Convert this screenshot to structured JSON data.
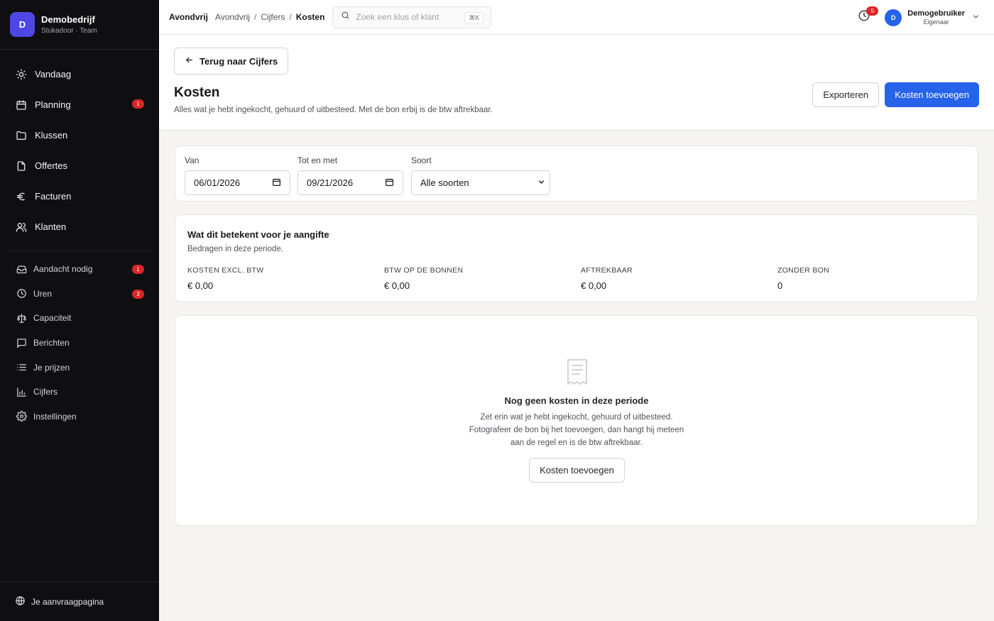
{
  "org": {
    "avatar": "D",
    "name": "Demobedrijf",
    "subtitle": "Stukadoor · Team"
  },
  "nav_main": [
    {
      "label": "Vandaag",
      "icon": "sun-icon"
    },
    {
      "label": "Planning",
      "icon": "calendar-icon",
      "badge": "1"
    },
    {
      "label": "Klussen",
      "icon": "folder-icon"
    },
    {
      "label": "Offertes",
      "icon": "document-icon"
    },
    {
      "label": "Facturen",
      "icon": "euro-icon"
    },
    {
      "label": "Klanten",
      "icon": "users-icon"
    }
  ],
  "nav_secondary": [
    {
      "label": "Aandacht nodig",
      "icon": "inbox-icon",
      "badge": "1"
    },
    {
      "label": "Uren",
      "icon": "clock-icon",
      "badge": "3"
    },
    {
      "label": "Capaciteit",
      "icon": "scale-icon"
    },
    {
      "label": "Berichten",
      "icon": "message-icon"
    },
    {
      "label": "Je prijzen",
      "icon": "list-icon"
    },
    {
      "label": "Cijfers",
      "icon": "bar-chart-icon"
    },
    {
      "label": "Instellingen",
      "icon": "gear-icon"
    }
  ],
  "sidebar_footer": {
    "label": "Je aanvraagpagina",
    "icon": "globe-icon"
  },
  "topbar": {
    "brand": "Avondvrij",
    "breadcrumb": [
      "Avondvrij",
      "Cijfers",
      "Kosten"
    ],
    "breadcrumb_sep": "/",
    "search_placeholder": "Zoek een klus of klant",
    "search_shortcut": "⌘K",
    "notification_count": "5",
    "user": {
      "avatar": "D",
      "name": "Demogebruiker",
      "role": "Eigenaar"
    }
  },
  "header": {
    "back_label": "Terug naar Cijfers",
    "title": "Kosten",
    "description": "Alles wat je hebt ingekocht, gehuurd of uitbesteed. Met de bon erbij is de btw aftrekbaar.",
    "export_label": "Exporteren",
    "add_label": "Kosten toevoegen"
  },
  "filters": {
    "from_label": "Van",
    "from_value": "06/01/2026",
    "to_label": "Tot en met",
    "to_value": "09/21/2026",
    "type_label": "Soort",
    "type_value": "Alle soorten"
  },
  "summary": {
    "title": "Wat dit betekent voor je aangifte",
    "subtitle": "Bedragen in deze periode.",
    "stats": [
      {
        "label": "KOSTEN EXCL. BTW",
        "value": "€ 0,00"
      },
      {
        "label": "BTW OP DE BONNEN",
        "value": "€ 0,00"
      },
      {
        "label": "AFTREKBAAR",
        "value": "€ 0,00"
      },
      {
        "label": "ZONDER BON",
        "value": "0"
      }
    ]
  },
  "empty": {
    "title": "Nog geen kosten in deze periode",
    "line1": "Zet erin wat je hebt ingekocht, gehuurd of uitbesteed.",
    "line2": "Fotografeer de bon bij het toevoegen, dan hangt hij meteen",
    "line3": "aan de regel en is de btw aftrekbaar.",
    "button_label": "Kosten toevoegen"
  },
  "colors": {
    "sidebar_bg": "#0f0f12",
    "accent": "#2563eb",
    "badge": "#dc2626",
    "org_avatar": "#4f46e5"
  }
}
